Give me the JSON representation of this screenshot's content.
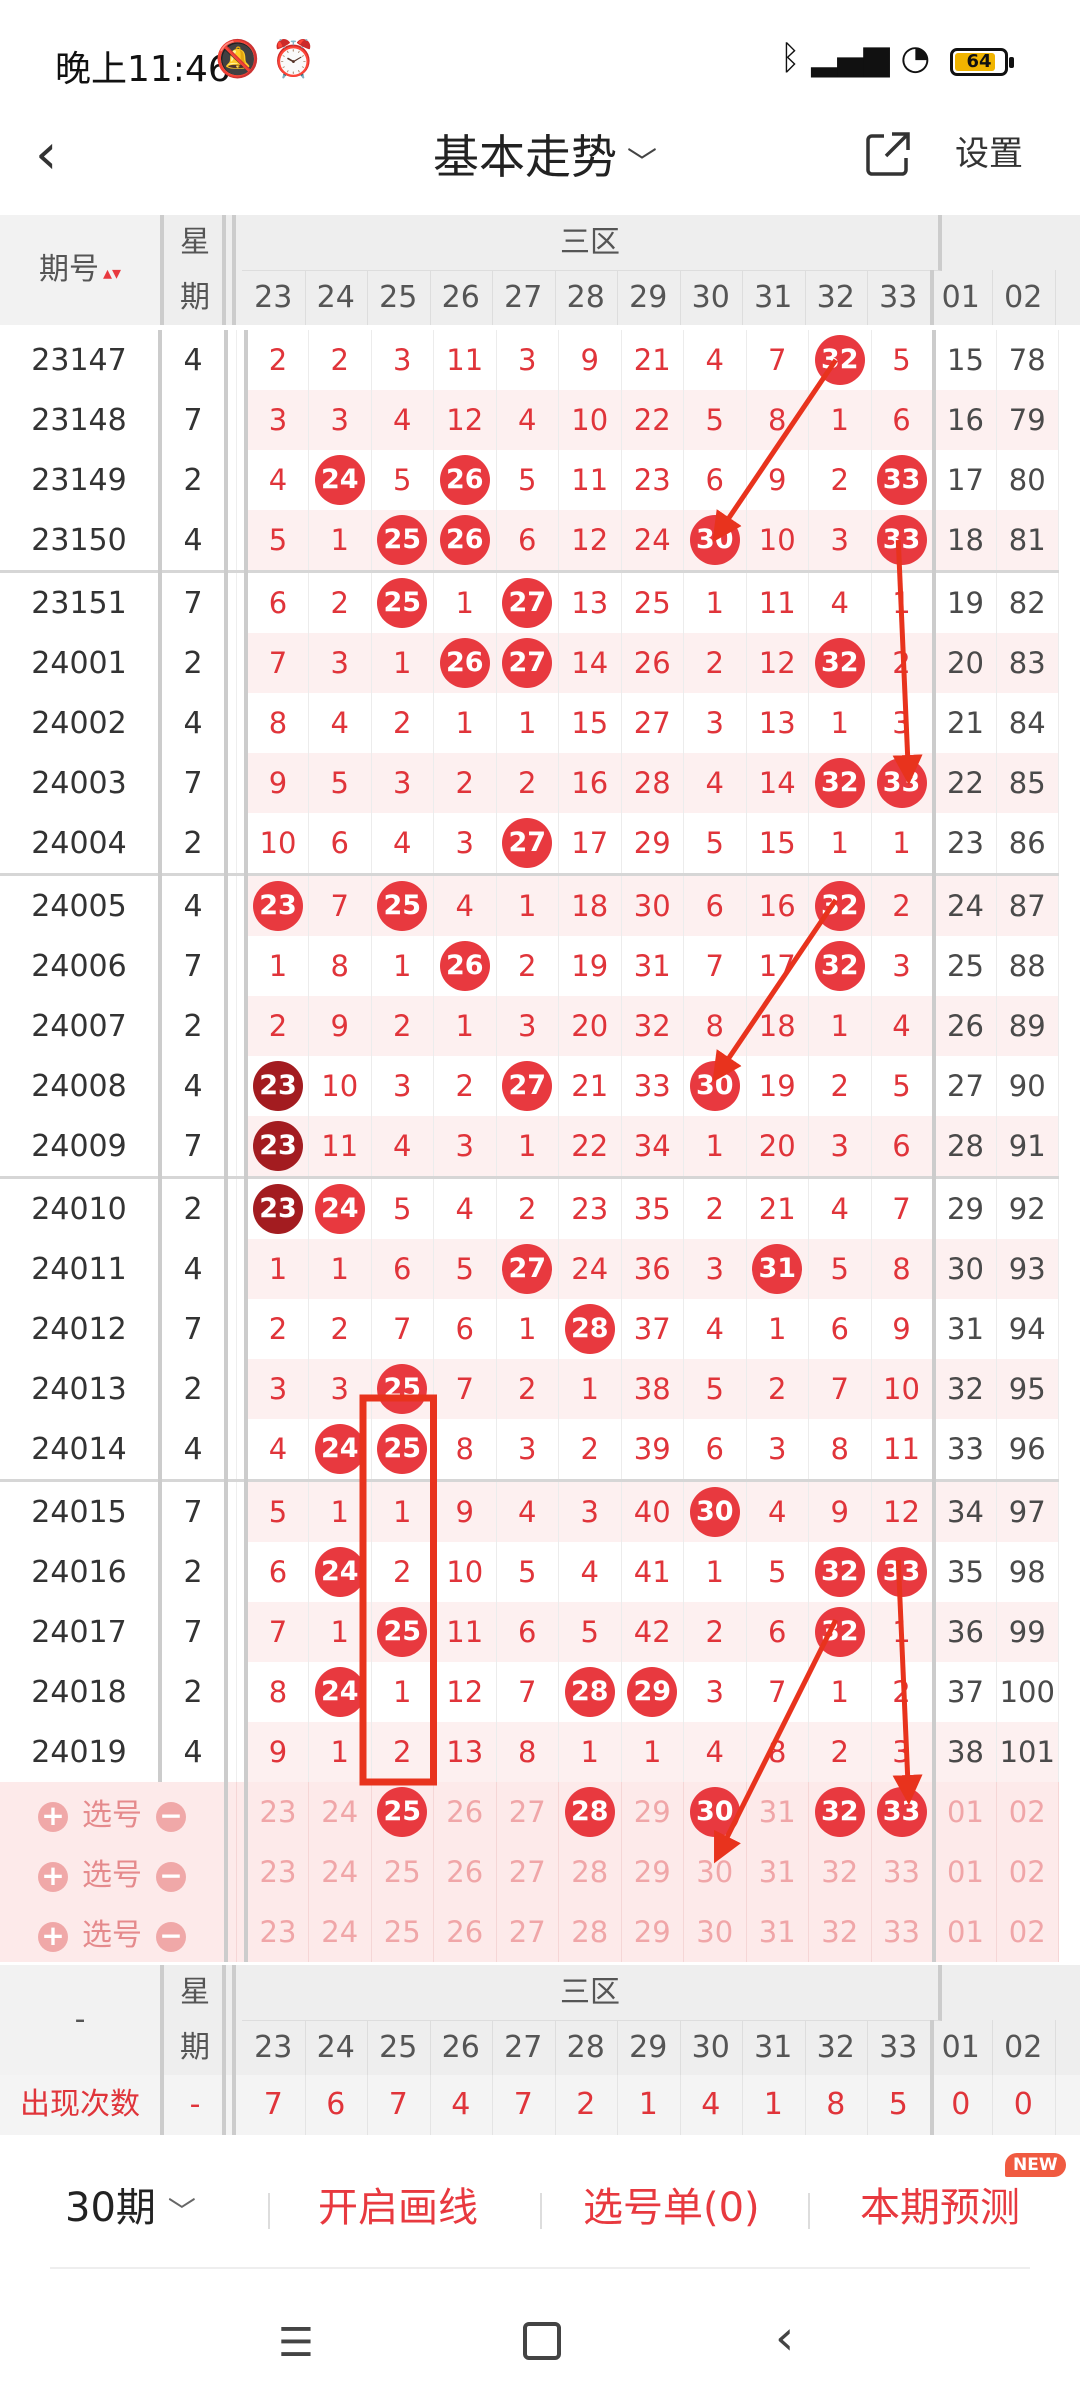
{
  "status_bar": {
    "time": "晚上11:46",
    "battery": "64"
  },
  "header": {
    "title": "基本走势",
    "settings_label": "设置"
  },
  "table_header": {
    "issue_label": "期号",
    "week_top": "星",
    "week_bottom": "期",
    "zone_label": "三区",
    "columns": [
      "23",
      "24",
      "25",
      "26",
      "27",
      "28",
      "29",
      "30",
      "31",
      "32",
      "33",
      "01",
      "02"
    ]
  },
  "rows": [
    {
      "issue": "23147",
      "week": "4",
      "cells": [
        "2",
        "2",
        "3",
        "11",
        "3",
        "9",
        "21",
        "4",
        "7",
        "32",
        "5",
        "15",
        "78"
      ],
      "balls": [
        9
      ],
      "dark": [],
      "sep": false
    },
    {
      "issue": "23148",
      "week": "7",
      "cells": [
        "3",
        "3",
        "4",
        "12",
        "4",
        "10",
        "22",
        "5",
        "8",
        "1",
        "6",
        "16",
        "79"
      ],
      "balls": [],
      "dark": [],
      "sep": false
    },
    {
      "issue": "23149",
      "week": "2",
      "cells": [
        "4",
        "24",
        "5",
        "26",
        "5",
        "11",
        "23",
        "6",
        "9",
        "2",
        "33",
        "17",
        "80"
      ],
      "balls": [
        1,
        3,
        10
      ],
      "dark": [],
      "sep": false
    },
    {
      "issue": "23150",
      "week": "4",
      "cells": [
        "5",
        "1",
        "25",
        "26",
        "6",
        "12",
        "24",
        "30",
        "10",
        "3",
        "33",
        "18",
        "81"
      ],
      "balls": [
        2,
        3,
        7,
        10
      ],
      "dark": [],
      "sep": false
    },
    {
      "issue": "23151",
      "week": "7",
      "cells": [
        "6",
        "2",
        "25",
        "1",
        "27",
        "13",
        "25",
        "1",
        "11",
        "4",
        "1",
        "19",
        "82"
      ],
      "balls": [
        2,
        4
      ],
      "dark": [],
      "sep": true
    },
    {
      "issue": "24001",
      "week": "2",
      "cells": [
        "7",
        "3",
        "1",
        "26",
        "27",
        "14",
        "26",
        "2",
        "12",
        "32",
        "2",
        "20",
        "83"
      ],
      "balls": [
        3,
        4,
        9
      ],
      "dark": [],
      "sep": false
    },
    {
      "issue": "24002",
      "week": "4",
      "cells": [
        "8",
        "4",
        "2",
        "1",
        "1",
        "15",
        "27",
        "3",
        "13",
        "1",
        "3",
        "21",
        "84"
      ],
      "balls": [],
      "dark": [],
      "sep": false
    },
    {
      "issue": "24003",
      "week": "7",
      "cells": [
        "9",
        "5",
        "3",
        "2",
        "2",
        "16",
        "28",
        "4",
        "14",
        "32",
        "33",
        "22",
        "85"
      ],
      "balls": [
        9,
        10
      ],
      "dark": [],
      "sep": false
    },
    {
      "issue": "24004",
      "week": "2",
      "cells": [
        "10",
        "6",
        "4",
        "3",
        "27",
        "17",
        "29",
        "5",
        "15",
        "1",
        "1",
        "23",
        "86"
      ],
      "balls": [
        4
      ],
      "dark": [],
      "sep": false
    },
    {
      "issue": "24005",
      "week": "4",
      "cells": [
        "23",
        "7",
        "25",
        "4",
        "1",
        "18",
        "30",
        "6",
        "16",
        "32",
        "2",
        "24",
        "87"
      ],
      "balls": [
        0,
        2,
        9
      ],
      "dark": [],
      "sep": true
    },
    {
      "issue": "24006",
      "week": "7",
      "cells": [
        "1",
        "8",
        "1",
        "26",
        "2",
        "19",
        "31",
        "7",
        "17",
        "32",
        "3",
        "25",
        "88"
      ],
      "balls": [
        3,
        9
      ],
      "dark": [],
      "sep": false
    },
    {
      "issue": "24007",
      "week": "2",
      "cells": [
        "2",
        "9",
        "2",
        "1",
        "3",
        "20",
        "32",
        "8",
        "18",
        "1",
        "4",
        "26",
        "89"
      ],
      "balls": [],
      "dark": [],
      "sep": false
    },
    {
      "issue": "24008",
      "week": "4",
      "cells": [
        "23",
        "10",
        "3",
        "2",
        "27",
        "21",
        "33",
        "30",
        "19",
        "2",
        "5",
        "27",
        "90"
      ],
      "balls": [
        4,
        7
      ],
      "dark": [
        0
      ],
      "sep": false
    },
    {
      "issue": "24009",
      "week": "7",
      "cells": [
        "23",
        "11",
        "4",
        "3",
        "1",
        "22",
        "34",
        "1",
        "20",
        "3",
        "6",
        "28",
        "91"
      ],
      "balls": [],
      "dark": [
        0
      ],
      "sep": false
    },
    {
      "issue": "24010",
      "week": "2",
      "cells": [
        "23",
        "24",
        "5",
        "4",
        "2",
        "23",
        "35",
        "2",
        "21",
        "4",
        "7",
        "29",
        "92"
      ],
      "balls": [
        1
      ],
      "dark": [
        0
      ],
      "sep": true
    },
    {
      "issue": "24011",
      "week": "4",
      "cells": [
        "1",
        "1",
        "6",
        "5",
        "27",
        "24",
        "36",
        "3",
        "31",
        "5",
        "8",
        "30",
        "93"
      ],
      "balls": [
        4,
        8
      ],
      "dark": [],
      "sep": false
    },
    {
      "issue": "24012",
      "week": "7",
      "cells": [
        "2",
        "2",
        "7",
        "6",
        "1",
        "28",
        "37",
        "4",
        "1",
        "6",
        "9",
        "31",
        "94"
      ],
      "balls": [
        5
      ],
      "dark": [],
      "sep": false
    },
    {
      "issue": "24013",
      "week": "2",
      "cells": [
        "3",
        "3",
        "25",
        "7",
        "2",
        "1",
        "38",
        "5",
        "2",
        "7",
        "10",
        "32",
        "95"
      ],
      "balls": [
        2
      ],
      "dark": [],
      "sep": false
    },
    {
      "issue": "24014",
      "week": "4",
      "cells": [
        "4",
        "24",
        "25",
        "8",
        "3",
        "2",
        "39",
        "6",
        "3",
        "8",
        "11",
        "33",
        "96"
      ],
      "balls": [
        1,
        2
      ],
      "dark": [],
      "sep": false
    },
    {
      "issue": "24015",
      "week": "7",
      "cells": [
        "5",
        "1",
        "1",
        "9",
        "4",
        "3",
        "40",
        "30",
        "4",
        "9",
        "12",
        "34",
        "97"
      ],
      "balls": [
        7
      ],
      "dark": [],
      "sep": true
    },
    {
      "issue": "24016",
      "week": "2",
      "cells": [
        "6",
        "24",
        "2",
        "10",
        "5",
        "4",
        "41",
        "1",
        "5",
        "32",
        "33",
        "35",
        "98"
      ],
      "balls": [
        1,
        9,
        10
      ],
      "dark": [],
      "sep": false
    },
    {
      "issue": "24017",
      "week": "7",
      "cells": [
        "7",
        "1",
        "25",
        "11",
        "6",
        "5",
        "42",
        "2",
        "6",
        "32",
        "1",
        "36",
        "99"
      ],
      "balls": [
        2,
        9
      ],
      "dark": [],
      "sep": false
    },
    {
      "issue": "24018",
      "week": "2",
      "cells": [
        "8",
        "24",
        "1",
        "12",
        "7",
        "28",
        "29",
        "3",
        "7",
        "1",
        "2",
        "37",
        "100"
      ],
      "balls": [
        1,
        5,
        6
      ],
      "dark": [],
      "sep": false
    },
    {
      "issue": "24019",
      "week": "4",
      "cells": [
        "9",
        "1",
        "2",
        "13",
        "8",
        "1",
        "1",
        "4",
        "8",
        "2",
        "3",
        "38",
        "101"
      ],
      "balls": [],
      "dark": [],
      "sep": false
    }
  ],
  "pick_rows": [
    {
      "label": "选号",
      "balls": [
        2,
        5,
        7,
        9,
        10
      ]
    },
    {
      "label": "选号",
      "balls": []
    },
    {
      "label": "选号",
      "balls": []
    }
  ],
  "footer": {
    "issue_label": "-",
    "week_top": "星",
    "week_bottom": "期",
    "zone_label": "三区",
    "count_label": "出现次数",
    "count_week": "-",
    "counts": [
      "7",
      "6",
      "7",
      "4",
      "7",
      "2",
      "1",
      "4",
      "1",
      "8",
      "5",
      "0",
      "0"
    ]
  },
  "bottom_bar": {
    "period": "30期",
    "draw_lines": "开启画线",
    "selection": "选号单(0)",
    "predict": "本期预测",
    "new_badge": "NEW"
  },
  "colors": {
    "red": "#e8393f",
    "dark_red": "#a31c20",
    "annotation": "#e8331d"
  }
}
